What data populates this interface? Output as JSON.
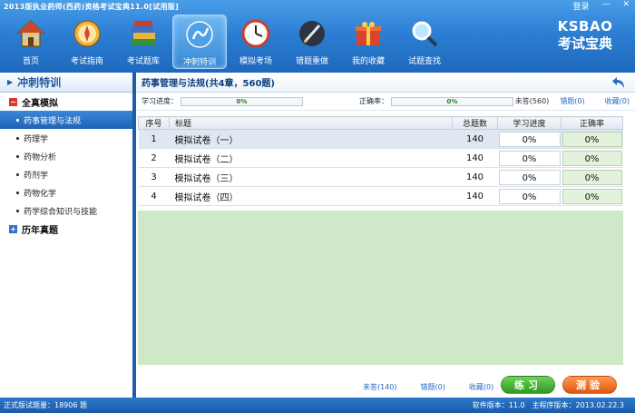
{
  "window": {
    "title": "2013版执业药师(西药)资格考试宝典11.0[试用版]",
    "controls": [
      "登录",
      "—",
      "✕"
    ]
  },
  "logo": {
    "brand": "KSBAO",
    "subtitle": "考试宝典"
  },
  "toolbar": {
    "items": [
      {
        "label": "首页",
        "icon": "home-icon"
      },
      {
        "label": "考试指南",
        "icon": "compass-icon"
      },
      {
        "label": "考试题库",
        "icon": "books-icon"
      },
      {
        "label": "冲刺特训",
        "icon": "sprint-icon",
        "active": true
      },
      {
        "label": "模拟考场",
        "icon": "clock-icon"
      },
      {
        "label": "错题重做",
        "icon": "pen-icon"
      },
      {
        "label": "我的收藏",
        "icon": "gift-box-icon"
      },
      {
        "label": "试题查找",
        "icon": "magnifier-icon"
      }
    ]
  },
  "sidebar": {
    "header": "冲刺特训",
    "group1": "全真模拟",
    "items": [
      "药事管理与法规",
      "药理学",
      "药物分析",
      "药剂学",
      "药物化学",
      "药学综合知识与技能"
    ],
    "selected_index": 0,
    "group2": "历年真题"
  },
  "main": {
    "title": "药事管理与法规(共4章，560题)",
    "study_progress_label": "学习进度：",
    "study_progress_value": "0%",
    "study_progress_fraction": 0,
    "accuracy_label": "正确率：",
    "accuracy_value": "0%",
    "accuracy_fraction": 0,
    "stats": {
      "unanswered": "未答(560)",
      "wrong": "错题(0)",
      "favorites": "收藏(0)"
    },
    "table": {
      "headers": [
        "序号",
        "标题",
        "总题数",
        "学习进度",
        "正确率"
      ],
      "rows": [
        {
          "idx": "1",
          "title": "模拟试卷（一）",
          "total": "140",
          "progress": "0%",
          "accuracy": "0%"
        },
        {
          "idx": "2",
          "title": "模拟试卷（二）",
          "total": "140",
          "progress": "0%",
          "accuracy": "0%"
        },
        {
          "idx": "3",
          "title": "模拟试卷（三）",
          "total": "140",
          "progress": "0%",
          "accuracy": "0%"
        },
        {
          "idx": "4",
          "title": "模拟试卷（四）",
          "total": "140",
          "progress": "0%",
          "accuracy": "0%"
        }
      ]
    },
    "bottom": {
      "unanswered": "未答(140)",
      "wrong": "错题(0)",
      "favorites": "收藏(0)"
    },
    "buttons": {
      "practice": "练习",
      "test": "测验"
    }
  },
  "statusbar": {
    "left": "正式版试题量：18906 题",
    "software_version": "软件版本：11.0",
    "program_version": "主程序版本：2013.02.22.3"
  },
  "colors": {
    "accent": "#2c7fd3",
    "selected": "#1e64b8",
    "green_area": "#cfe8c8",
    "practice": "#2c9a1e",
    "test": "#e0560f"
  }
}
